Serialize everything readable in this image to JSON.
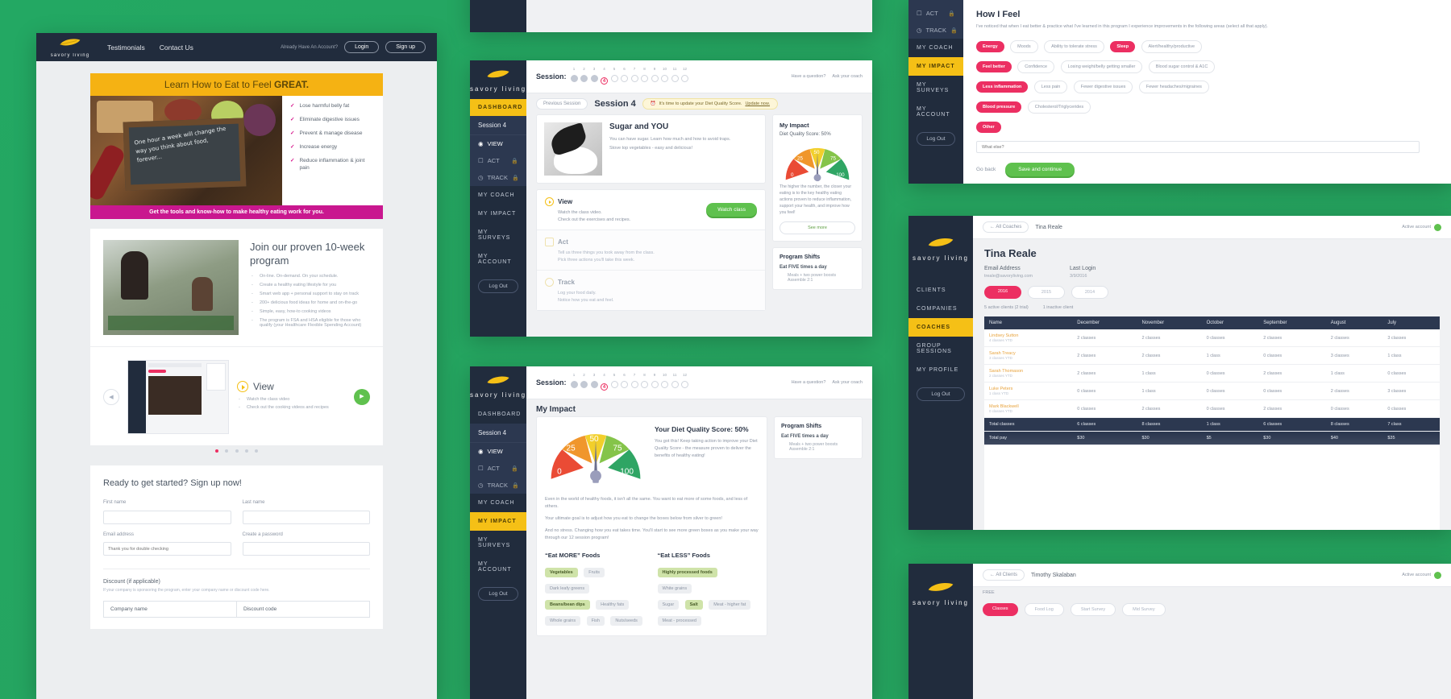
{
  "brand": {
    "name": "savory living",
    "logo_icon": "leaf-icon"
  },
  "marketing": {
    "nav": {
      "items": [
        "Testimonials",
        "Contact Us"
      ],
      "account_prompt": "Already Have An Account?",
      "login": "Login",
      "signup": "Sign up"
    },
    "hero": {
      "headline_plain": "Learn How to Eat to Feel ",
      "headline_bold": "GREAT.",
      "chalkboard": "One hour a week will change the way you think about food, forever...",
      "benefits": [
        "Lose harmful belly fat",
        "Eliminate digestive issues",
        "Prevent & manage disease",
        "Increase energy",
        "Reduce inflammation & joint pain"
      ],
      "footer_band": "Get the tools and know-how to make healthy eating work for you."
    },
    "program": {
      "title": "Join our proven 10-week program",
      "bullets": [
        "On-line. On-demand. On your schedule.",
        "Create a healthy eating lifestyle for you",
        "Smart web app + personal support to stay on track",
        "200+ delicious food ideas for home and on-the-go",
        "Simple, easy, how-to cooking videos",
        "The program is FSA and HSA eligible for those who qualify (your Healthcare Flexible Spending Account)"
      ]
    },
    "view_block": {
      "title": "View",
      "bullets": [
        "Watch the class video",
        "Check out the cooking videos and recipes"
      ],
      "prev_arrow": "◀",
      "next_arrow": "▶",
      "dots": 5,
      "active_dot": 1
    },
    "signup": {
      "heading": "Ready to get started? Sign up now!",
      "fields": [
        {
          "label": "First name",
          "value": "",
          "placeholder": ""
        },
        {
          "label": "Last name",
          "value": "",
          "placeholder": ""
        },
        {
          "label": "Email address",
          "value": "",
          "placeholder": "Thank you for double checking"
        },
        {
          "label": "Create a password",
          "value": "",
          "placeholder": ""
        }
      ],
      "discount_heading": "Discount (if applicable)",
      "discount_sub": "If your company is sponsoring the program, enter your company name or discount code here.",
      "discount_fields": [
        {
          "label": "Company name",
          "value": ""
        },
        {
          "label": "Discount code",
          "value": ""
        }
      ]
    }
  },
  "session_nav": {
    "label": "Session:",
    "numbers": [
      "1",
      "2",
      "3",
      "4",
      "5",
      "6",
      "7",
      "8",
      "9",
      "10",
      "11",
      "12"
    ],
    "completed": 3,
    "current": 4,
    "help_links": [
      "Have a question?",
      "Ask your coach"
    ]
  },
  "sidebar": {
    "dashboard": "DASHBOARD",
    "session_label": "Session 4",
    "steps": [
      {
        "label": "VIEW",
        "icon": "play-circle-icon",
        "locked": false
      },
      {
        "label": "ACT",
        "icon": "check-square-icon",
        "locked": true
      },
      {
        "label": "TRACK",
        "icon": "clock-icon",
        "locked": true
      }
    ],
    "links": [
      "MY COACH",
      "MY IMPACT",
      "MY SURVEYS",
      "MY ACCOUNT"
    ],
    "logout": "Log Out"
  },
  "dashboard": {
    "prev_session": "Previous Session",
    "title": "Session 4",
    "alert_icon": "bell-icon",
    "alert": "It's time to update your Diet Quality Score.",
    "alert_link": "Update now.",
    "lesson": {
      "title": "Sugar and YOU",
      "line1": "You can have sugar. Learn how much and how to avoid traps.",
      "line2": "Stove top vegetables - easy and delicious!"
    },
    "steps": [
      {
        "title": "View",
        "icon": "play-circle-icon",
        "lines": [
          "Watch the class video.",
          "Check out the exercises and recipes."
        ],
        "cta": "Watch class"
      },
      {
        "title": "Act",
        "icon": "check-square-icon",
        "lines": [
          "Tell us three things you took away from the class.",
          "Pick three actions you'll take this week."
        ],
        "cta": ""
      },
      {
        "title": "Track",
        "icon": "clock-icon",
        "lines": [
          "Log your food daily.",
          "Notice how you eat and feel."
        ],
        "cta": ""
      }
    ],
    "impact_card": {
      "title": "My Impact",
      "score_label": "Diet Quality Score: 50%",
      "body": "The higher the number, the closer your eating is to the key healthy eating actions proven to reduce inflammation, support your health, and improve how you feel!",
      "cta": "See more"
    },
    "shifts_card": {
      "title": "Program Shifts",
      "subtitle": "Eat FIVE times a day",
      "items": [
        "Meals + two power boosts",
        "Assemble 2:1"
      ]
    }
  },
  "my_impact": {
    "page_title": "My Impact",
    "score_title": "Your Diet Quality Score: 50%",
    "score_body": "You got this! Keep taking action to improve your Diet Quality Score - the measure proven to deliver the benefits of healthy eating!",
    "paragraphs": [
      "Even in the world of healthy foods, it isn't all the same. You want to eat more of some foods, and less of others.",
      "Your ultimate goal is to adjust how you eat to change the boxes below from silver to green!",
      "And no stress. Changing how you eat takes time. You'll start to see more green boxes as you make your way through our 12 session program!"
    ],
    "eat_more_title": "“Eat MORE” Foods",
    "eat_less_title": "“Eat LESS” Foods",
    "eat_more": [
      {
        "label": "Vegetables",
        "selected": true
      },
      {
        "label": "Fruits",
        "selected": false
      },
      {
        "label": "Dark leafy greens",
        "selected": false
      },
      {
        "label": "Beans/bean dips",
        "selected": true
      },
      {
        "label": "Healthy fats",
        "selected": false
      },
      {
        "label": "Whole grains",
        "selected": false
      },
      {
        "label": "Fish",
        "selected": false
      },
      {
        "label": "Nuts/seeds",
        "selected": false
      }
    ],
    "eat_less": [
      {
        "label": "Highly processed foods",
        "selected": true
      },
      {
        "label": "White grains",
        "selected": false
      },
      {
        "label": "Sugar",
        "selected": false
      },
      {
        "label": "Salt",
        "selected": true
      },
      {
        "label": "Meat - higher fat",
        "selected": false
      },
      {
        "label": "Meat - processed",
        "selected": false
      }
    ],
    "shifts_card": {
      "title": "Program Shifts",
      "subtitle": "Eat FIVE times a day",
      "items": [
        "Meals + two power boosts",
        "Assemble 2:1"
      ]
    }
  },
  "chart_data": {
    "type": "gauge",
    "title": "Diet Quality Score",
    "value": 50,
    "min": 0,
    "max": 100,
    "tick_labels": [
      "0",
      "25",
      "50",
      "75",
      "100"
    ],
    "bands": [
      {
        "from": 0,
        "to": 20,
        "color": "#ea4b35"
      },
      {
        "from": 20,
        "to": 40,
        "color": "#f0962c"
      },
      {
        "from": 40,
        "to": 60,
        "color": "#f2cf2b"
      },
      {
        "from": 60,
        "to": 80,
        "color": "#85c44a"
      },
      {
        "from": 80,
        "to": 100,
        "color": "#2fa564"
      }
    ],
    "unit": "%"
  },
  "how_i_feel": {
    "title": "How I Feel",
    "intro": "I've noticed that when I eat better & practice what I've learned in this program I experience improvements in the following areas (select all that apply).",
    "rows": [
      [
        {
          "label": "Energy",
          "selected": true
        },
        {
          "label": "Moods",
          "selected": false
        },
        {
          "label": "Ability to tolerate stress",
          "selected": false
        },
        {
          "label": "Sleep",
          "selected": true
        },
        {
          "label": "Alert/healthy/productive",
          "selected": false
        }
      ],
      [
        {
          "label": "Feel better",
          "selected": true
        },
        {
          "label": "Confidence",
          "selected": false
        },
        {
          "label": "Losing weight/belly getting smaller",
          "selected": false
        },
        {
          "label": "Blood sugar control & A1C",
          "selected": false
        }
      ],
      [
        {
          "label": "Less inflammation",
          "selected": true
        },
        {
          "label": "Less pain",
          "selected": false
        },
        {
          "label": "Fewer digestive issues",
          "selected": false
        },
        {
          "label": "Fewer headaches/migraines",
          "selected": false
        }
      ],
      [
        {
          "label": "Blood pressure",
          "selected": true
        },
        {
          "label": "Cholesterol/Triglycerides",
          "selected": false
        }
      ],
      [
        {
          "label": "Other",
          "selected": true
        }
      ]
    ],
    "other_placeholder": "What else?",
    "back": "Go back",
    "save": "Save and continue"
  },
  "coach": {
    "breadcrumb_back": "← All Coaches",
    "breadcrumb_name": "Tina Reale",
    "account_status": "Active account",
    "name": "Tina Reale",
    "email_label": "Email Address",
    "email": "treale@savoryliving.com",
    "login_label": "Last Login",
    "login": "3/9/2016",
    "years": [
      {
        "label": "2016",
        "active": true
      },
      {
        "label": "2015",
        "active": false
      },
      {
        "label": "2014",
        "active": false
      }
    ],
    "counts": [
      "5 active clients (2 trial)",
      "1 inactive client"
    ],
    "nav": [
      "CLIENTS",
      "COMPANIES",
      "COACHES",
      "GROUP SESSIONS",
      "MY PROFILE"
    ],
    "logout": "Log Out",
    "table": {
      "headers": [
        "Name",
        "December",
        "November",
        "October",
        "September",
        "August",
        "July"
      ],
      "rows": [
        {
          "name": "Lindsey Sutton",
          "sub": "4 classes YTD",
          "cells": [
            "2 classes",
            "2 classes",
            "0 classes",
            "2 classes",
            "2 classes",
            "3 classes"
          ]
        },
        {
          "name": "Sarah Treacy",
          "sub": "3 classes YTD",
          "cells": [
            "2 classes",
            "2 classes",
            "1 class",
            "0 classes",
            "3 classes",
            "1 class"
          ]
        },
        {
          "name": "Sarah Thomason",
          "sub": "2 classes YTD",
          "cells": [
            "2 classes",
            "1 class",
            "0 classes",
            "2 classes",
            "1 class",
            "0 classes"
          ]
        },
        {
          "name": "Luke Peters",
          "sub": "1 class YTD",
          "cells": [
            "0 classes",
            "1 class",
            "0 classes",
            "0 classes",
            "2 classes",
            "3 classes"
          ]
        },
        {
          "name": "Mark Blackwell",
          "sub": "0 classes YTD",
          "cells": [
            "0 classes",
            "2 classes",
            "0 classes",
            "2 classes",
            "0 classes",
            "0 classes"
          ]
        }
      ],
      "total_classes": {
        "label": "Total classes",
        "cells": [
          "6 classes",
          "8 classes",
          "1 class",
          "6 classes",
          "8 classes",
          "7 class"
        ]
      },
      "total_pay": {
        "label": "Total pay",
        "cells": [
          "$30",
          "$30",
          "$5",
          "$30",
          "$40",
          "$35"
        ]
      }
    }
  },
  "client": {
    "breadcrumb_back": "← All Clients",
    "name": "Timothy Skalaban",
    "plan": "FREE",
    "account_status": "Active account",
    "tabs": [
      {
        "label": "Classes",
        "active": true
      },
      {
        "label": "Food Log",
        "active": false
      },
      {
        "label": "Start Survey",
        "active": false
      },
      {
        "label": "Mid Survey",
        "active": false
      }
    ]
  }
}
